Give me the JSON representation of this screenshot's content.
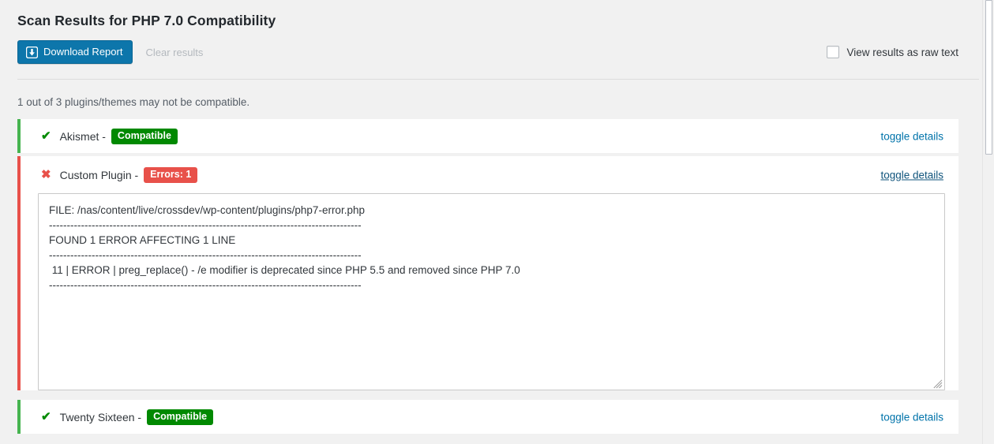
{
  "page": {
    "title": "Scan Results for PHP 7.0 Compatibility",
    "summary": "1 out of 3 plugins/themes may not be compatible."
  },
  "toolbar": {
    "download_label": "Download Report",
    "download_icon": "download-icon",
    "clear_label": "Clear results",
    "raw_text_label": "View results as raw text",
    "raw_text_checked": false,
    "accent_color": "#0d76ab"
  },
  "results": [
    {
      "name": "Akismet -",
      "status": "compatible",
      "status_icon": "check-icon",
      "badge": "Compatible",
      "badge_color": "#018901",
      "bar_color": "#46b450",
      "toggle_label": "toggle details",
      "toggle_hovered": false,
      "expanded": false,
      "details": ""
    },
    {
      "name": "Custom Plugin -",
      "status": "error",
      "status_icon": "x-icon",
      "badge": "Errors: 1",
      "badge_color": "#e8514a",
      "bar_color": "#e8514a",
      "toggle_label": "toggle details",
      "toggle_hovered": true,
      "expanded": true,
      "details": "FILE: /nas/content/live/crossdev/wp-content/plugins/php7-error.php\n----------------------------------------------------------------------------------------\nFOUND 1 ERROR AFFECTING 1 LINE\n----------------------------------------------------------------------------------------\n 11 | ERROR | preg_replace() - /e modifier is deprecated since PHP 5.5 and removed since PHP 7.0\n----------------------------------------------------------------------------------------"
    },
    {
      "name": "Twenty Sixteen -",
      "status": "compatible",
      "status_icon": "check-icon",
      "badge": "Compatible",
      "badge_color": "#018901",
      "bar_color": "#46b450",
      "toggle_label": "toggle details",
      "toggle_hovered": false,
      "expanded": false,
      "details": ""
    }
  ],
  "glyphs": {
    "check": "✔",
    "cross": "✖"
  }
}
